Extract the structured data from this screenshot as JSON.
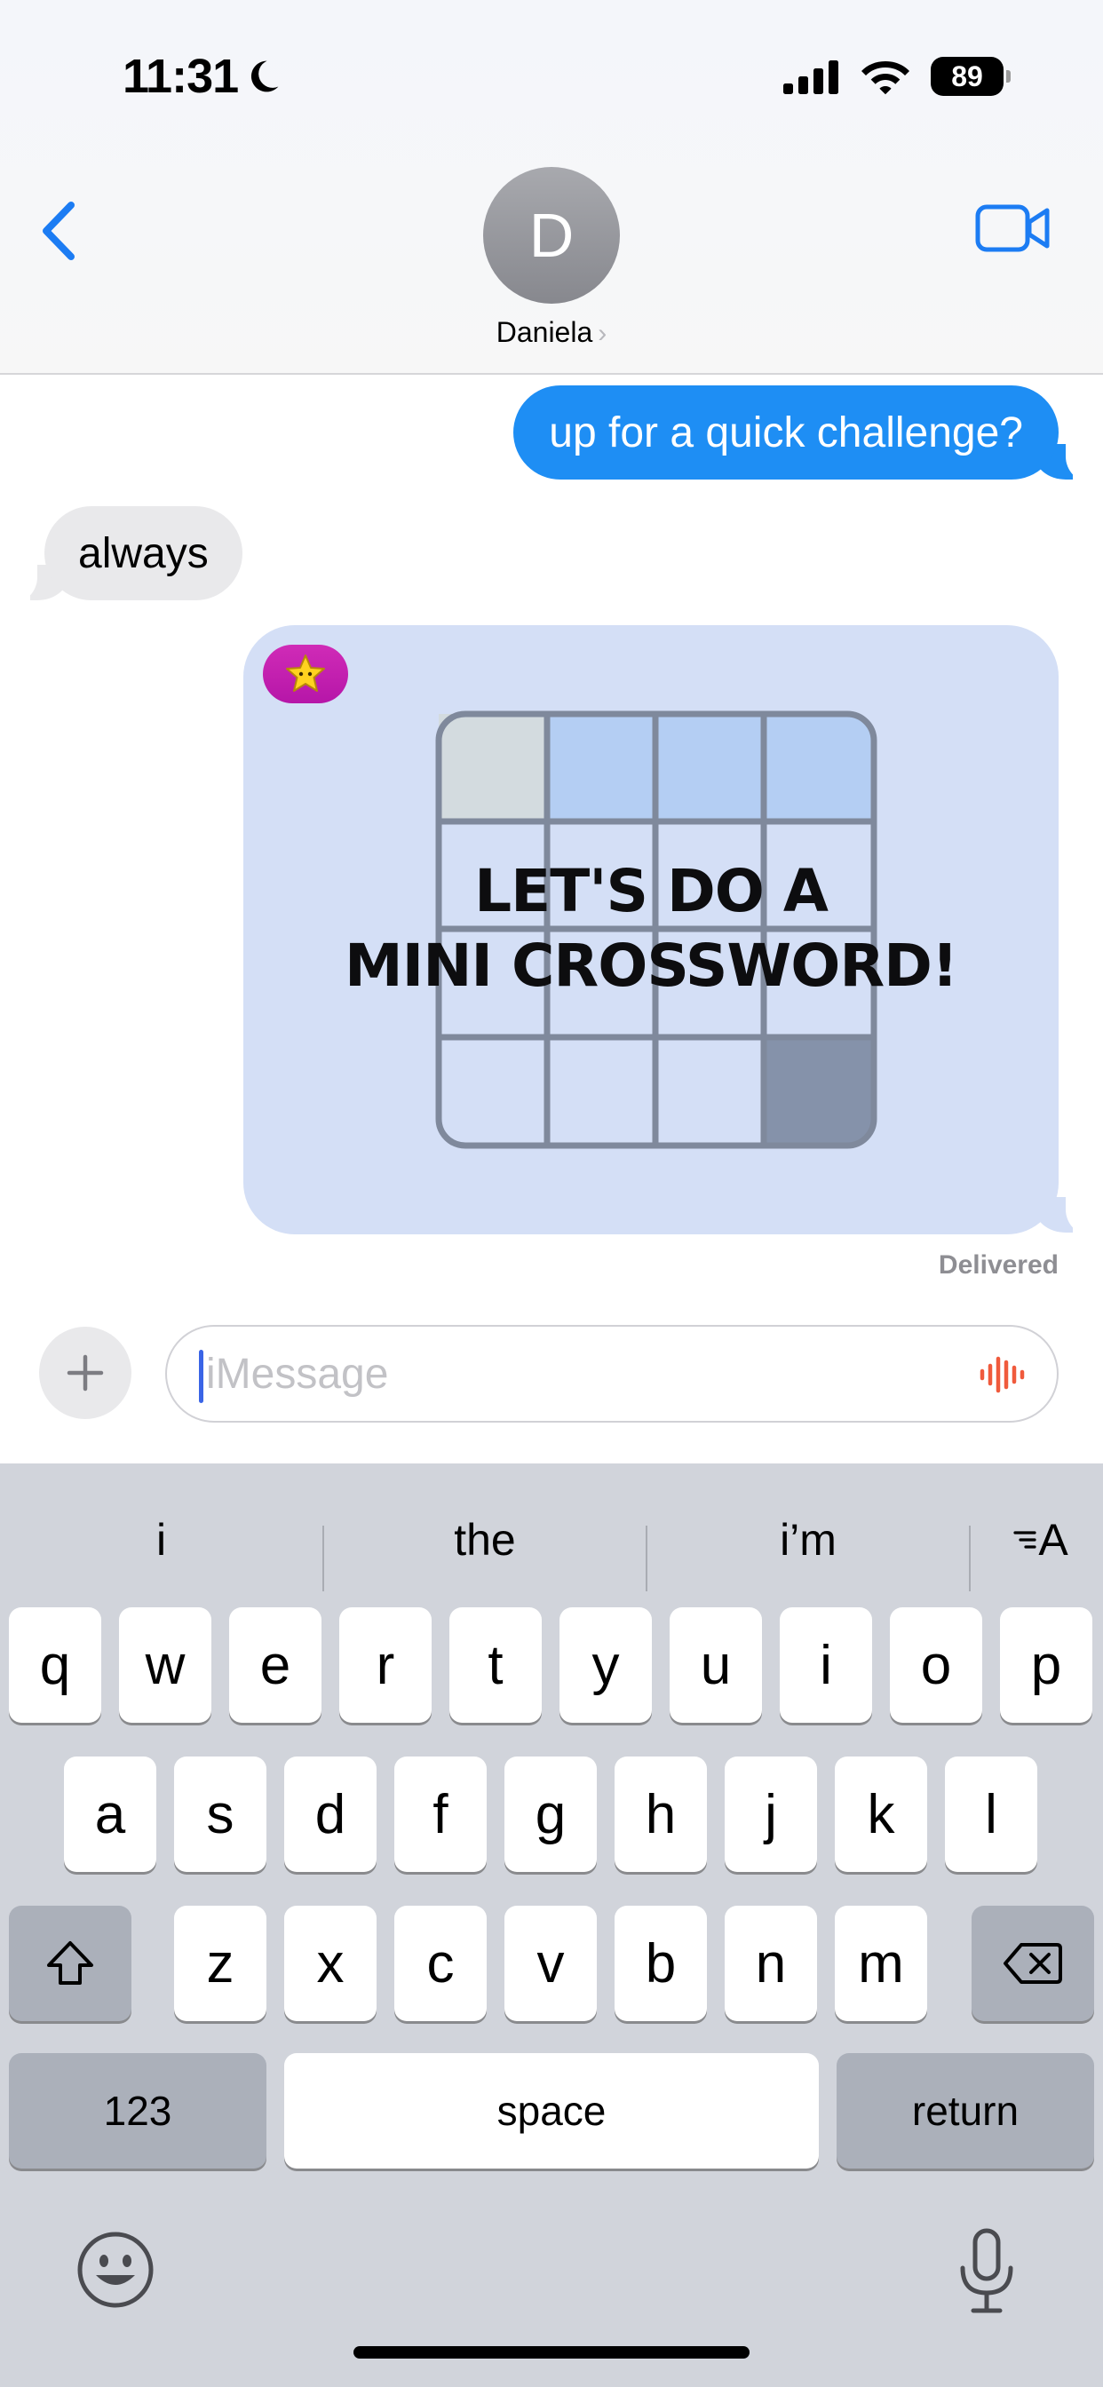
{
  "status_bar": {
    "time": "11:31",
    "focus_icon": "moon-icon",
    "battery": "89"
  },
  "header": {
    "avatar_initial": "D",
    "contact_name": "Daniela",
    "back_icon": "chevron-left-icon",
    "video_icon": "video-camera-icon",
    "accent_color": "#1c7cf3"
  },
  "messages": {
    "outgoing_1": "up for a quick challenge?",
    "incoming_1": "always",
    "game_card": {
      "title_line1": "LET'S DO A",
      "title_line2": "MINI CROSSWORD!",
      "badge_icon": "star-icon"
    },
    "status": "Delivered",
    "outgoing_color": "#1e8ef4",
    "incoming_color": "#e9e9eb"
  },
  "compose": {
    "placeholder": "iMessage",
    "plus_icon": "plus-icon",
    "voice_icon": "waveform-icon"
  },
  "keyboard": {
    "suggestions": [
      "i",
      "the",
      "i’m"
    ],
    "text_format_label": "A",
    "row1": [
      "q",
      "w",
      "e",
      "r",
      "t",
      "y",
      "u",
      "i",
      "o",
      "p"
    ],
    "row2": [
      "a",
      "s",
      "d",
      "f",
      "g",
      "h",
      "j",
      "k",
      "l"
    ],
    "row3": [
      "z",
      "x",
      "c",
      "v",
      "b",
      "n",
      "m"
    ],
    "numbers_label": "123",
    "space_label": "space",
    "return_label": "return",
    "shift_icon": "shift-icon",
    "delete_icon": "delete-icon",
    "emoji_icon": "emoji-icon",
    "mic_icon": "microphone-icon"
  }
}
